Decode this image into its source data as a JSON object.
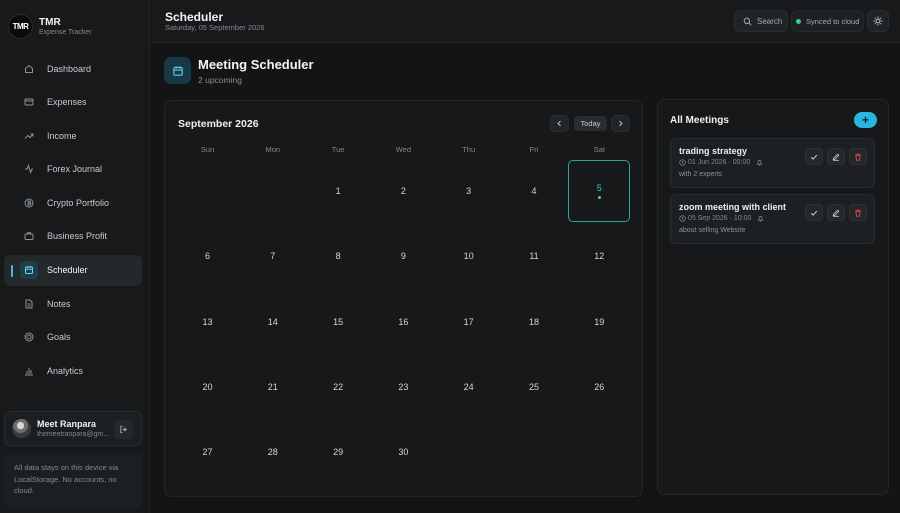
{
  "brand": {
    "logo_text": "TMR",
    "title": "TMR",
    "subtitle": "Expense Tracker"
  },
  "sidebar": {
    "items": [
      {
        "label": "Dashboard",
        "icon": "home-icon"
      },
      {
        "label": "Expenses",
        "icon": "card-icon"
      },
      {
        "label": "Income",
        "icon": "trend-up-icon"
      },
      {
        "label": "Forex Journal",
        "icon": "activity-icon"
      },
      {
        "label": "Crypto Portfolio",
        "icon": "bitcoin-icon"
      },
      {
        "label": "Business Profit",
        "icon": "briefcase-icon"
      },
      {
        "label": "Scheduler",
        "icon": "calendar-icon",
        "active": true
      },
      {
        "label": "Notes",
        "icon": "document-icon"
      },
      {
        "label": "Goals",
        "icon": "target-icon"
      },
      {
        "label": "Analytics",
        "icon": "bar-chart-icon"
      }
    ],
    "user": {
      "name": "Meet Ranpara",
      "email": "themeetranpara@gm..."
    },
    "storage_note": "All data stays on this device via LocalStorage. No accounts, no cloud."
  },
  "header": {
    "title": "Scheduler",
    "date": "Saturday, 05 September 2026",
    "search_label": "Search",
    "sync_label": "Synced to cloud"
  },
  "section": {
    "title": "Meeting Scheduler",
    "subtitle": "2 upcoming"
  },
  "calendar": {
    "month_label": "September 2026",
    "today_label": "Today",
    "weekdays": [
      "Sun",
      "Mon",
      "Tue",
      "Wed",
      "Thu",
      "Fri",
      "Sat"
    ],
    "first_weekday": 2,
    "days_in_month": 30,
    "today": 5
  },
  "meetings": {
    "title": "All Meetings",
    "add_label": "+",
    "items": [
      {
        "title": "trading strategy",
        "datetime": "01 Jun 2026 · 00:00",
        "description": "with 2 experts"
      },
      {
        "title": "zoom meeting with client",
        "datetime": "05 Sep 2026 · 10:00",
        "description": "about selling Website"
      }
    ]
  },
  "colors": {
    "accent": "#2ab6e0",
    "today": "#3fd2b0",
    "delete": "#e0474c",
    "synced": "#34d08a"
  }
}
